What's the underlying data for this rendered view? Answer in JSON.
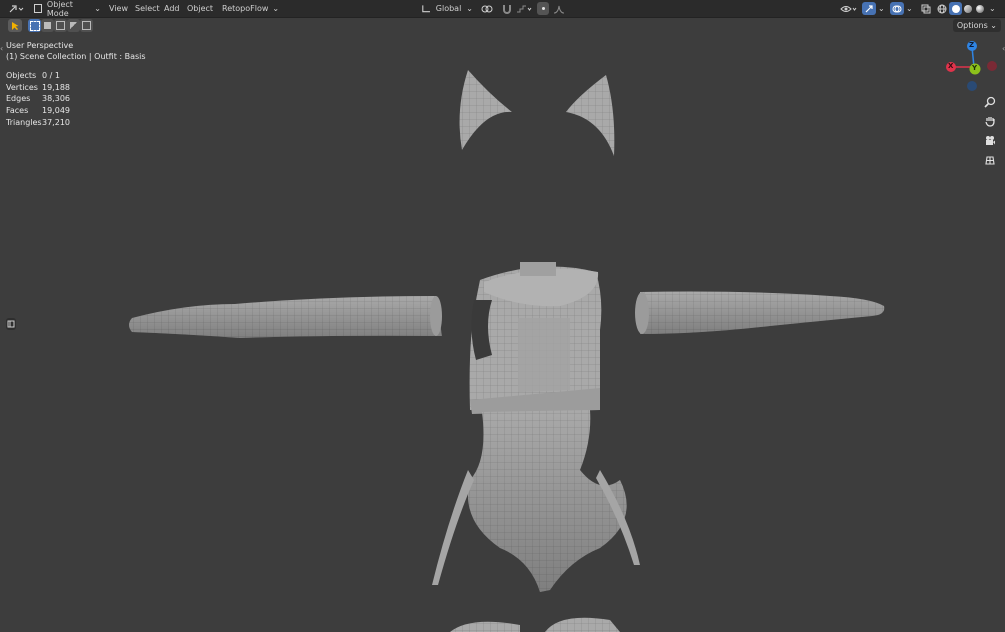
{
  "header": {
    "editor_icon": "editor-type-icon",
    "mode_label": "Object Mode",
    "menus": [
      "View",
      "Select",
      "Add",
      "Object"
    ],
    "addon_menu": "RetopoFlow",
    "orientation_label": "Global"
  },
  "toolbar": {
    "options_label": "Options"
  },
  "viewport": {
    "perspective_label": "User Perspective",
    "collection_label": "(1) Scene Collection | Outfit : Basis",
    "stats": [
      {
        "key": "Objects",
        "value": "0 / 1"
      },
      {
        "key": "Vertices",
        "value": "19,188"
      },
      {
        "key": "Edges",
        "value": "38,306"
      },
      {
        "key": "Faces",
        "value": "19,049"
      },
      {
        "key": "Triangles",
        "value": "37,210"
      }
    ]
  },
  "gizmo": {
    "axis_z": "Z",
    "axis_y": "Y",
    "axis_x": "X",
    "colors": {
      "x": "#e0334b",
      "y": "#8dc11b",
      "z": "#2f84e3"
    }
  },
  "nav_icons": [
    "zoom-icon",
    "hand-pan-icon",
    "camera-icon",
    "grid-ortho-icon"
  ],
  "colors": {
    "accent": "#4772b3",
    "header_bg": "#2b2b2b",
    "viewport_bg": "#3d3d3d"
  }
}
